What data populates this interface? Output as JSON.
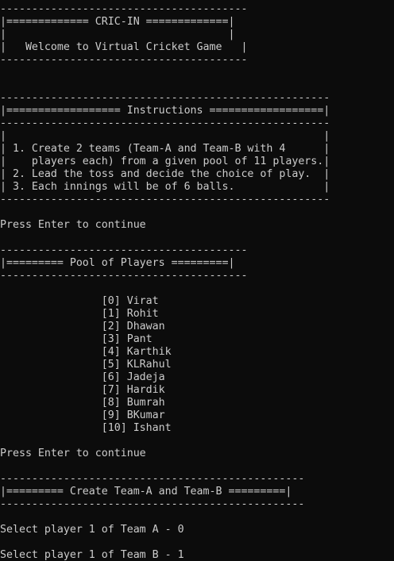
{
  "console": {
    "line_0": "---------------------------------------",
    "line_1": "|============= CRIC-IN =============|",
    "line_2": "|                                   |",
    "line_3": "|   Welcome to Virtual Cricket Game   |",
    "line_4": "---------------------------------------",
    "line_5": "",
    "line_6": "",
    "line_7": "----------------------------------------------------",
    "line_8": "|================== Instructions ==================|",
    "line_9": "----------------------------------------------------",
    "line_10": "|                                                  |",
    "line_11": "| 1. Create 2 teams (Team-A and Team-B with 4      |",
    "line_12": "|    players each) from a given pool of 11 players.|",
    "line_13": "| 2. Lead the toss and decide the choice of play.  |",
    "line_14": "| 3. Each innings will be of 6 balls.              |",
    "line_15": "----------------------------------------------------",
    "line_16": "",
    "line_17": "Press Enter to continue",
    "line_18": "",
    "line_19": "---------------------------------------",
    "line_20": "|========= Pool of Players =========|",
    "line_21": "---------------------------------------",
    "line_22": "",
    "line_23": "                [0] Virat",
    "line_24": "                [1] Rohit",
    "line_25": "                [2] Dhawan",
    "line_26": "                [3] Pant",
    "line_27": "                [4] Karthik",
    "line_28": "                [5] KLRahul",
    "line_29": "                [6] Jadeja",
    "line_30": "                [7] Hardik",
    "line_31": "                [8] Bumrah",
    "line_32": "                [9] BKumar",
    "line_33": "                [10] Ishant",
    "line_34": "",
    "line_35": "Press Enter to continue",
    "line_36": "",
    "line_37": "------------------------------------------------",
    "line_38": "|========= Create Team-A and Team-B =========|",
    "line_39": "------------------------------------------------",
    "line_40": "",
    "line_41": "Select player 1 of Team A - 0",
    "line_42": "",
    "line_43": "Select player 1 of Team B - 1"
  }
}
